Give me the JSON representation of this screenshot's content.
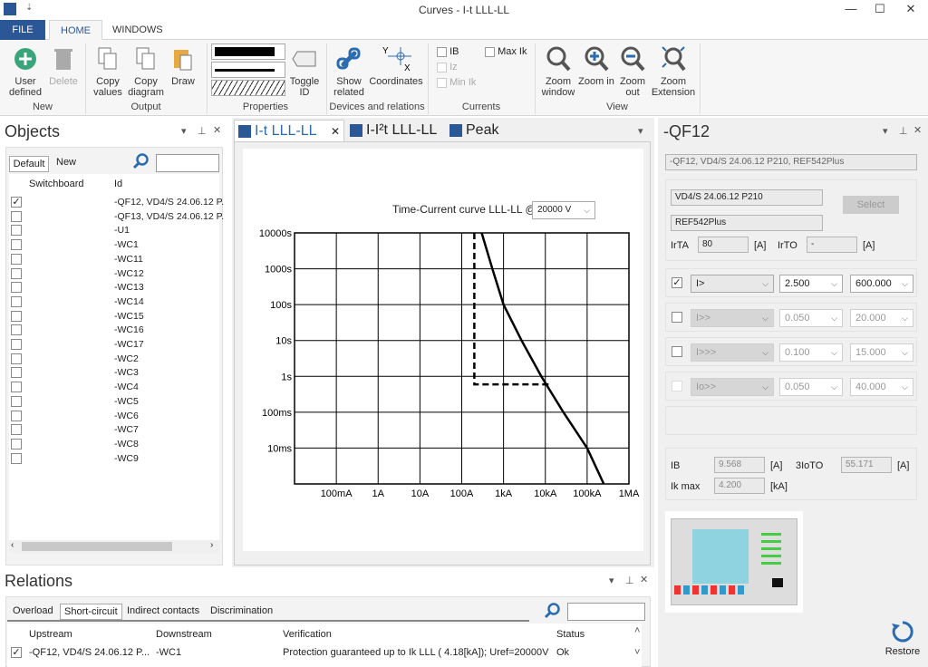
{
  "window": {
    "title": "Curves - I-t LLL-LL",
    "minimize": "—",
    "maximize": "☐",
    "close": "✕"
  },
  "ribbon_tabs": [
    "FILE",
    "HOME",
    "WINDOWS"
  ],
  "ribbon": {
    "groups": [
      {
        "label": "New",
        "buttons": [
          "User defined",
          "Delete"
        ]
      },
      {
        "label": "Output",
        "buttons": [
          "Copy values",
          "Copy diagram",
          "Draw"
        ]
      },
      {
        "label": "Properties",
        "buttons": [
          "Toggle ID"
        ]
      },
      {
        "label": "Devices and relations",
        "buttons": [
          "Show related",
          "Coordinates"
        ]
      },
      {
        "label": "Currents",
        "checks": [
          "IB",
          "Iz",
          "Min Ik",
          "Max Ik"
        ]
      },
      {
        "label": "View",
        "buttons": [
          "Zoom window",
          "Zoom in",
          "Zoom out",
          "Zoom Extension"
        ]
      }
    ]
  },
  "objects": {
    "title": "Objects",
    "tabs": [
      "Default",
      "New"
    ],
    "columns": [
      "Switchboard",
      "Id"
    ],
    "rows": [
      {
        "id": "-QF12, VD4/S 24.06.12 P.",
        "checked": true
      },
      {
        "id": "-QF13, VD4/S 24.06.12 P.",
        "checked": false
      },
      {
        "id": "-U1"
      },
      {
        "id": "-WC1"
      },
      {
        "id": "-WC11"
      },
      {
        "id": "-WC12"
      },
      {
        "id": "-WC13"
      },
      {
        "id": "-WC14"
      },
      {
        "id": "-WC15"
      },
      {
        "id": "-WC16"
      },
      {
        "id": "-WC17"
      },
      {
        "id": "-WC2"
      },
      {
        "id": "-WC3"
      },
      {
        "id": "-WC4"
      },
      {
        "id": "-WC5"
      },
      {
        "id": "-WC6"
      },
      {
        "id": "-WC7"
      },
      {
        "id": "-WC8"
      },
      {
        "id": "-WC9"
      }
    ]
  },
  "doc_tabs": [
    "I-t LLL-LL",
    "I-I²t LLL-LL",
    "Peak"
  ],
  "chart_header": {
    "label": "Time-Current curve LLL-LL @",
    "voltage": "20000 V"
  },
  "chart_data": {
    "type": "line",
    "title": "",
    "xlabel": "",
    "ylabel": "",
    "x_scale": "log",
    "y_scale": "log",
    "xlim": [
      0.01,
      1000000
    ],
    "ylim": [
      0.001,
      10000
    ],
    "grid": true,
    "x_ticks": [
      {
        "v": 0.1,
        "label": "100mA"
      },
      {
        "v": 1,
        "label": "1A"
      },
      {
        "v": 10,
        "label": "10A"
      },
      {
        "v": 100,
        "label": "100A"
      },
      {
        "v": 1000,
        "label": "1kA"
      },
      {
        "v": 10000,
        "label": "10kA"
      },
      {
        "v": 100000,
        "label": "100kA"
      },
      {
        "v": 1000000,
        "label": "1MA"
      }
    ],
    "y_ticks": [
      {
        "v": 10000,
        "label": "10000s"
      },
      {
        "v": 1000,
        "label": "1000s"
      },
      {
        "v": 100,
        "label": "100s"
      },
      {
        "v": 10,
        "label": "10s"
      },
      {
        "v": 1,
        "label": "1s"
      },
      {
        "v": 0.1,
        "label": "100ms"
      },
      {
        "v": 0.01,
        "label": "10ms"
      }
    ],
    "series": [
      {
        "style": "solid",
        "color": "#000000",
        "x": [
          300,
          540,
          1000,
          2700,
          8000,
          27000,
          100000,
          250000
        ],
        "y": [
          10000,
          1000,
          100,
          10,
          1,
          0.1,
          0.01,
          0.001
        ]
      },
      {
        "style": "dashed",
        "color": "#000000",
        "x": [
          200,
          200,
          12000
        ],
        "y": [
          10000,
          0.6,
          0.6
        ]
      }
    ]
  },
  "relations": {
    "title": "Relations",
    "tabs": [
      "Overload",
      "Short-circuit",
      "Indirect contacts",
      "Discrimination"
    ],
    "columns": [
      "Upstream",
      "Downstream",
      "Verification",
      "Status"
    ],
    "rows": [
      {
        "upstream": "-QF12, VD4/S 24.06.12 P...",
        "downstream": "-WC1",
        "verification": "Protection guaranteed up to Ik LLL ( 4.18[kA]); Uref=20000V",
        "status": "Ok"
      }
    ]
  },
  "props": {
    "title": "-QF12",
    "summary": "-QF12, VD4/S 24.06.12 P210, REF542Plus",
    "device": "VD4/S 24.06.12 P210",
    "relay": "REF542Plus",
    "select": "Select",
    "irta_label": "IrTA",
    "irta": "80",
    "irto_label": "IrTO",
    "irto": "-",
    "unit_a": "[A]",
    "unit_ka": "[kA]",
    "protections": [
      {
        "checked": true,
        "enabled": true,
        "fn": "I>",
        "mult": "2.500",
        "time": "600.000"
      },
      {
        "checked": false,
        "enabled": false,
        "fn": "I>>",
        "mult": "0.050",
        "time": "20.000"
      },
      {
        "checked": false,
        "enabled": false,
        "fn": "I>>>",
        "mult": "0.100",
        "time": "15.000"
      },
      {
        "checked": false,
        "enabled": false,
        "fn": "Io>>",
        "mult": "0.050",
        "time": "40.000"
      }
    ],
    "ib_label": "IB",
    "ib": "9.568",
    "i3o_label": "3IoTO",
    "i3o": "55.171",
    "ikmax_label": "Ik max",
    "ikmax": "4.200",
    "restore": "Restore"
  }
}
